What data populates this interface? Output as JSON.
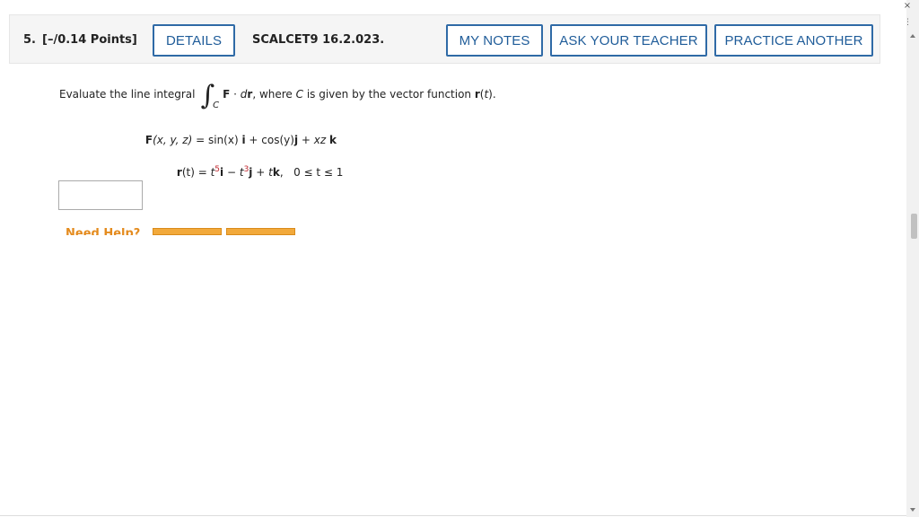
{
  "question": {
    "number": "5.",
    "points": "[–/0.14 Points]",
    "source": "SCALCET9 16.2.023."
  },
  "buttons": {
    "details": "DETAILS",
    "my_notes": "MY NOTES",
    "ask_teacher": "ASK YOUR TEACHER",
    "practice_another": "PRACTICE ANOTHER"
  },
  "prompt": {
    "lead": "Evaluate the line integral",
    "integral_symbol": "∫",
    "subscript": "C",
    "F": "F",
    "dot": " · ",
    "dr_d": "d",
    "dr_r": "r",
    "where": ", where ",
    "C": "C",
    "rest": " is given by the vector function ",
    "r": "r",
    "t_open": "(",
    "t": "t",
    "t_close": ")."
  },
  "equations": {
    "F_lhs_F": "F",
    "F_lhs_args": "(x, y, z)",
    "F_eq": " = ",
    "F_term1": "sin(x)",
    "F_i": "i",
    "F_plus1": " + ",
    "F_term2": "cos(y)",
    "F_j": "j",
    "F_plus2": " + ",
    "F_term3": "xz",
    "F_k": "k",
    "r_lhs_r": "r",
    "r_lhs_args": "(t)",
    "r_eq": " = ",
    "r_t1": "t",
    "r_exp1": "5",
    "r_i": "i",
    "r_minus": " − ",
    "r_t2": "t",
    "r_exp2": "3",
    "r_j": "j",
    "r_plus": " + ",
    "r_t3": "t",
    "r_k": "k",
    "r_comma": ",",
    "r_range": "0 ≤ t ≤ 1"
  },
  "answer": {
    "value": ""
  },
  "help": {
    "label": "Need Help?"
  },
  "window": {
    "close": "×",
    "menu": "⋮"
  }
}
